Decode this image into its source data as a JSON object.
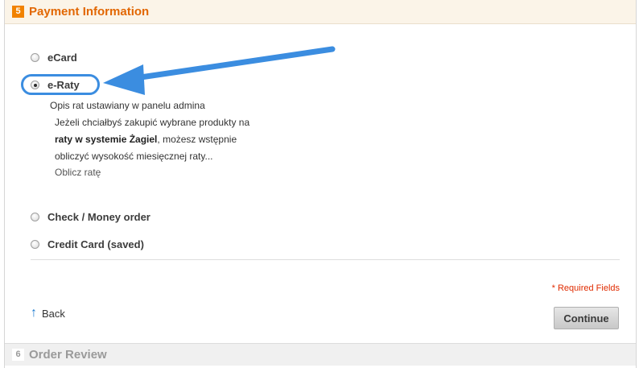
{
  "payment_step": {
    "number": "5",
    "title": "Payment Information"
  },
  "methods": [
    {
      "label": "eCard",
      "selected": false
    },
    {
      "label": "e-Raty",
      "selected": true
    },
    {
      "label": "Check / Money order",
      "selected": false
    },
    {
      "label": "Credit Card (saved)",
      "selected": false
    }
  ],
  "eraty_description": {
    "line1": "Opis rat ustawiany w panelu admina",
    "line2": "Jeżeli chciałbyś zakupić wybrane produkty na",
    "line3_bold": "raty w systemie Żagiel",
    "line3_rest": ", możesz wstępnie",
    "line4": "obliczyć wysokość miesięcznej raty...",
    "calc_link": "Oblicz ratę"
  },
  "required_note": "* Required Fields",
  "back_label": "Back",
  "continue_label": "Continue",
  "review_step": {
    "number": "6",
    "title": "Order Review"
  },
  "colors": {
    "accent_orange": "#e26703",
    "annotation_blue": "#3b8de0",
    "required_red": "#e02b00"
  },
  "icons": {
    "back": "arrow-up-icon",
    "annotation": "annotation-arrow-icon"
  }
}
